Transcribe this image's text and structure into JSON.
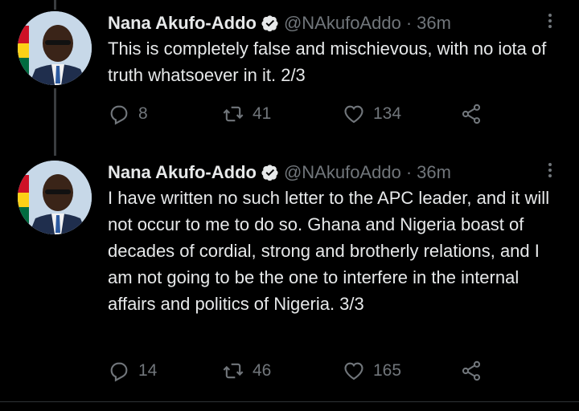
{
  "tweets": [
    {
      "name": "Nana Akufo-Addo",
      "handle": "@NAkufoAddo",
      "separator": "·",
      "time": "36m",
      "text": "This is completely false and mischievous, with no iota of truth whatsoever in it. 2/3",
      "replies": "8",
      "retweets": "41",
      "likes": "134"
    },
    {
      "name": "Nana Akufo-Addo",
      "handle": "@NAkufoAddo",
      "separator": "·",
      "time": "36m",
      "text": "I have written no such letter to the APC leader, and it will not occur to me to do so. Ghana and Nigeria boast of decades of cordial, strong and brotherly relations, and I am not going to be the one to interfere in the internal affairs and politics of Nigeria. 3/3",
      "replies": "14",
      "retweets": "46",
      "likes": "165"
    }
  ],
  "colors": {
    "background": "#000000",
    "primary_text": "#e7e9ea",
    "secondary_text": "#71767b",
    "verified_badge": "#e7e9ea"
  },
  "icons": [
    "verified-badge-icon",
    "more-options-icon",
    "reply-icon",
    "retweet-icon",
    "like-icon",
    "share-icon"
  ]
}
